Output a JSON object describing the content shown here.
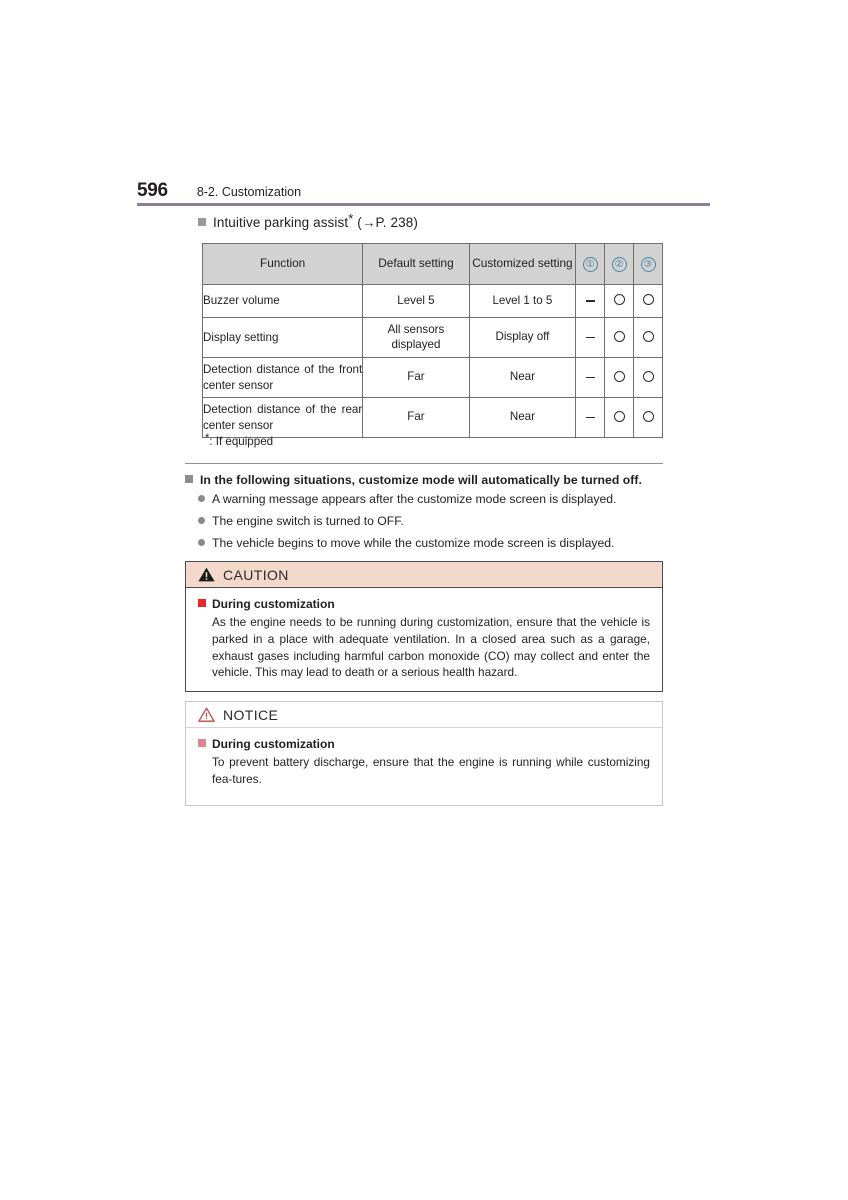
{
  "header": {
    "page_number": "596",
    "section": "8-2. Customization",
    "rule_color": "#8b7f93"
  },
  "section_heading": {
    "text": "Intuitive parking assist",
    "footnote_marker": "*",
    "reference": "(→P. 238)"
  },
  "table": {
    "columns": [
      "Function",
      "Default setting",
      "Customized setting"
    ],
    "marker_columns": [
      "①",
      "②",
      "③"
    ],
    "marker_color": "#4e82a8",
    "rows": [
      {
        "function": "Buzzer volume",
        "default": "Level 5",
        "customized": "Level 1 to 5",
        "marks": [
          "dash",
          "circle",
          "circle"
        ]
      },
      {
        "function": "Display setting",
        "default": "All sensors displayed",
        "customized": "Display off",
        "marks": [
          "dash",
          "circle",
          "circle"
        ]
      },
      {
        "function": "Detection distance of the front center sensor",
        "default": "Far",
        "customized": "Near",
        "marks": [
          "dash",
          "circle",
          "circle"
        ]
      },
      {
        "function": "Detection distance of the rear center sensor",
        "default": "Far",
        "customized": "Near",
        "marks": [
          "dash",
          "circle",
          "circle"
        ]
      }
    ],
    "footnote": ": If equipped",
    "footnote_star": "*"
  },
  "situations": {
    "heading": "In the following situations, customize mode will automatically be turned off.",
    "items": [
      "A warning message appears after the customize mode screen is displayed.",
      "The engine switch is turned to OFF.",
      "The vehicle begins to move while the customize mode screen is displayed."
    ]
  },
  "caution": {
    "title": "CAUTION",
    "icon": "warning-triangle-filled-icon",
    "header_bg": "#f3d9cc",
    "subheading": "During customization",
    "bullet_color": "#e8272c",
    "body": "As the engine needs to be running during customization, ensure that the vehicle is parked in a place with adequate ventilation. In a closed area such as a garage, exhaust gases including harmful carbon monoxide (CO) may collect and enter the vehicle. This may lead to death or a serious health hazard."
  },
  "notice": {
    "title": "NOTICE",
    "icon": "warning-triangle-outline-icon",
    "icon_color": "#c0474f",
    "subheading": "During customization",
    "bullet_color": "#d9868c",
    "body": "To prevent battery discharge, ensure that the engine is running while customizing fea-tures."
  }
}
